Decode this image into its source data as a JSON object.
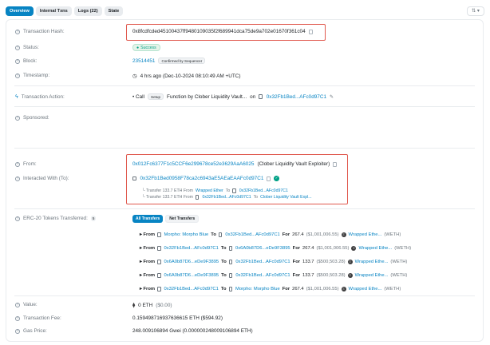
{
  "tabs": [
    {
      "label": "Overview",
      "active": true
    },
    {
      "label": "Internal Txns",
      "active": false
    },
    {
      "label": "Logs (22)",
      "active": false
    },
    {
      "label": "State",
      "active": false
    }
  ],
  "more_button": "⇅ ▾",
  "fields": {
    "tx_hash": {
      "label": "Transaction Hash:",
      "value": "0x8fcdfcded45100437ff9480109035f2f689941dca75de9a702e01670f361c04"
    },
    "status": {
      "label": "Status:",
      "value": "Success"
    },
    "block": {
      "label": "Block:",
      "value": "23514451",
      "badge": "Confirmed by Sequencer"
    },
    "timestamp": {
      "label": "Timestamp:",
      "value": "4 hrs ago (Dec-10-2024 08:10:49 AM +UTC)"
    },
    "action": {
      "label": "Transaction Action:",
      "prefix": "• Call",
      "method": "Setup",
      "function_text": "Function by Clober Liquidity Vault...",
      "on": "on",
      "address": "0x32Fb1Bed...AFc0d97C1"
    },
    "sponsored": {
      "label": "Sponsored:"
    },
    "from": {
      "label": "From:",
      "address": "0x012Fc6377F1c5CCF6e299678ce52e3629AaA6025",
      "tag": "(Clober Liquidity Vault Exploiter)"
    },
    "interacted": {
      "label": "Interacted With (To):",
      "address": "0x32Fb1Bed0958F78ca2c6943aE5AEaEAAFc0d97C1",
      "transfers": [
        {
          "prefix": "└ Transfer 133.7 ETH From",
          "from": "Wrapped Ether",
          "to_word": "To",
          "to": "0x32Fb1Bed...AFc0d97C1"
        },
        {
          "prefix": "└ Transfer 133.7 ETH From",
          "from": "0x32Fb1Bed...AFc0d97C1",
          "to_word": "To",
          "to": "Clober Liquidity Vault Expl..."
        }
      ]
    },
    "erc20": {
      "label": "ERC-20 Tokens Transferred:",
      "count": "5",
      "pills": [
        "All Transfers",
        "Net Transfers"
      ],
      "rows": [
        {
          "from": "Morpho: Morpho Blue",
          "to": "0x32Fb1Bed...AFc0d97C1",
          "amount": "267.4",
          "usd": "($1,001,006.55)",
          "token": "Wrapped Ethe...",
          "symbol": "(WETH)"
        },
        {
          "from": "0x32Fb1Bed...AFc0d97C1",
          "to": "0x6A0b87D6...eDe9F3895",
          "amount": "267.4",
          "usd": "($1,001,006.55)",
          "token": "Wrapped Ethe...",
          "symbol": "(WETH)"
        },
        {
          "from": "0x6A0b87D6...eDe9F3895",
          "to": "0x32Fb1Bed...AFc0d97C1",
          "amount": "133.7",
          "usd": "($500,503.28)",
          "token": "Wrapped Ethe...",
          "symbol": "(WETH)"
        },
        {
          "from": "0x6A0b87D6...eDe9F3895",
          "to": "0x32Fb1Bed...AFc0d97C1",
          "amount": "133.7",
          "usd": "($500,503.28)",
          "token": "Wrapped Ethe...",
          "symbol": "(WETH)"
        },
        {
          "from": "0x32Fb1Bed...AFc0d97C1",
          "to": "Morpho: Morpho Blue",
          "amount": "267.4",
          "usd": "($1,001,006.55)",
          "token": "Wrapped Ethe...",
          "symbol": "(WETH)"
        }
      ],
      "row_labels": {
        "from": "▸ From",
        "to": "To",
        "for": "For"
      }
    },
    "value": {
      "label": "Value:",
      "value": "0 ETH",
      "usd": "($0.00)"
    },
    "fee": {
      "label": "Transaction Fee:",
      "value": "0.159498716937636615 ETH ($594.92)"
    },
    "gas": {
      "label": "Gas Price:",
      "value": "248.009106894 Gwei (0.000000248009106894 ETH)"
    }
  },
  "colors": {
    "link": "#0784c3",
    "success": "#00a186",
    "highlight": "#e0594e"
  }
}
